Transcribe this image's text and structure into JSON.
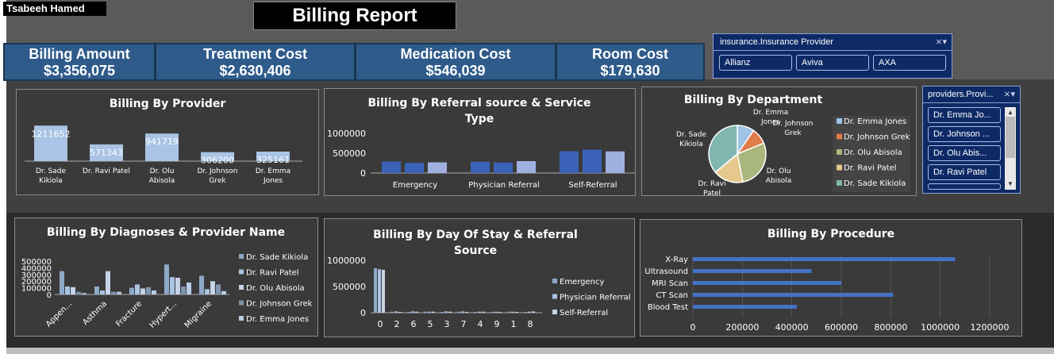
{
  "user_name": "Tsabeeh Hamed",
  "report_title": "Billing Report",
  "kpis": [
    {
      "label": "Billing Amount",
      "value": "$3,356,075"
    },
    {
      "label": "Treatment Cost",
      "value": "$2,630,406"
    },
    {
      "label": "Medication Cost",
      "value": "$546,039"
    },
    {
      "label": "Room Cost",
      "value": "$179,630"
    }
  ],
  "insurance_slicer": {
    "title": "insurance.Insurance Provider",
    "items": [
      "Allianz",
      "Aviva",
      "AXA"
    ]
  },
  "providers_slicer": {
    "title": "providers.Provi...",
    "items": [
      "Dr. Emma Jo...",
      "Dr. Johnson ...",
      "Dr. Olu Abis...",
      "Dr. Ravi Patel"
    ]
  },
  "colors": {
    "bar_light": "#a9c4e4",
    "bar_dark": "#3a63b8",
    "bar_pale": "#9fb0e0",
    "procedure_bar": "#4472c4"
  },
  "chart_data": [
    {
      "type": "bar",
      "title": "Billing By Provider",
      "categories": [
        "Dr. Sade Kikiola",
        "Dr. Ravi Patel",
        "Dr. Olu Abisola",
        "Dr. Johnson Grek",
        "Dr. Emma Jones"
      ],
      "values": [
        1211652,
        571343,
        941719,
        306200,
        325161
      ],
      "data_labels": [
        "1211652",
        "571343",
        "941719",
        "306200",
        "325161"
      ],
      "cat_lines": [
        [
          "Dr. Sade",
          "Kikiola"
        ],
        [
          "Dr. Ravi Patel"
        ],
        [
          "Dr. Olu",
          "Abisola"
        ],
        [
          "Dr. Johnson",
          "Grek"
        ],
        [
          "Dr. Emma",
          "Jones"
        ]
      ],
      "ylim": [
        0,
        1300000
      ]
    },
    {
      "type": "bar",
      "title": "Billing By Referral source & Service Type",
      "categories": [
        "Emergency",
        "Physician Referral",
        "Self-Referral"
      ],
      "series": [
        {
          "values": [
            290000,
            285000,
            550000
          ]
        },
        {
          "values": [
            255000,
            265000,
            590000
          ]
        },
        {
          "values": [
            270000,
            300000,
            545000
          ]
        }
      ],
      "yticks": [
        "1000000",
        "500000",
        "0"
      ],
      "ylim": [
        0,
        1000000
      ]
    },
    {
      "type": "pie",
      "title": "Billing By Department",
      "legend": [
        "Dr. Emma Jones",
        "Dr. Johnson Grek",
        "Dr. Olu Abisola",
        "Dr. Ravi Patel",
        "Dr. Sade Kikiola"
      ],
      "values": [
        325161,
        306200,
        941719,
        571343,
        1211652
      ],
      "labels": [
        [
          "Dr. Emma",
          "Jones"
        ],
        [
          "Dr. Johnson",
          "Grek"
        ],
        [
          "Dr. Olu",
          "Abisola"
        ],
        [
          "Dr. Ravi",
          "Patel"
        ],
        [
          "Dr. Sade",
          "Kikiola"
        ]
      ],
      "colors": [
        "#9dc3e6",
        "#e07b4a",
        "#a9b77c",
        "#e6c88c",
        "#7fb7b0"
      ]
    },
    {
      "type": "bar",
      "title": "Billing By Diagnoses & Provider Name",
      "categories": [
        "Appen...",
        "Asthma",
        "Fracture",
        "Hypert...",
        "Migraine"
      ],
      "legend": [
        "Dr. Sade Kikiola",
        "Dr. Ravi Patel",
        "Dr. Olu Abisola",
        "Dr. Johnson Grek",
        "Dr. Emma Jones"
      ],
      "series": [
        {
          "name": "Dr. Sade Kikiola",
          "values": [
            350000,
            120000,
            100000,
            450000,
            280000
          ]
        },
        {
          "name": "Dr. Ravi Patel",
          "values": [
            120000,
            60000,
            150000,
            260000,
            80000
          ]
        },
        {
          "name": "Dr. Olu Abisola",
          "values": [
            110000,
            350000,
            90000,
            250000,
            200000
          ]
        },
        {
          "name": "Dr. Johnson Grek",
          "values": [
            40000,
            40000,
            110000,
            120000,
            150000
          ]
        },
        {
          "name": "Dr. Emma Jones",
          "values": [
            20000,
            40000,
            60000,
            180000,
            50000
          ]
        }
      ],
      "yticks": [
        "500000",
        "400000",
        "300000",
        "200000",
        "100000",
        "0"
      ],
      "ylim": [
        0,
        500000
      ]
    },
    {
      "type": "bar",
      "title": "Billing By Day Of Stay & Referral Source",
      "categories": [
        "0",
        "2",
        "6",
        "5",
        "3",
        "7",
        "4",
        "9",
        "1",
        "8"
      ],
      "legend": [
        "Emergency",
        "Physician Referral",
        "Self-Referral"
      ],
      "series": [
        {
          "name": "Emergency",
          "values": [
            850000,
            20000,
            15000,
            20000,
            15000,
            20000,
            15000,
            15000,
            20000,
            15000
          ]
        },
        {
          "name": "Physician Referral",
          "values": [
            830000,
            25000,
            25000,
            20000,
            25000,
            25000,
            20000,
            20000,
            20000,
            20000
          ]
        },
        {
          "name": "Self-Referral",
          "values": [
            820000,
            15000,
            20000,
            20000,
            20000,
            15000,
            20000,
            15000,
            15000,
            25000
          ]
        }
      ],
      "yticks": [
        "1000000",
        "500000",
        "0"
      ],
      "ylim": [
        0,
        1000000
      ]
    },
    {
      "type": "bar",
      "title": "Billing By Procedure",
      "categories": [
        "X-Ray",
        "Ultrasound",
        "MRI Scan",
        "CT Scan",
        "Blood Test"
      ],
      "values": [
        1060000,
        480000,
        600000,
        810000,
        420000
      ],
      "xticks": [
        "0",
        "200000",
        "400000",
        "600000",
        "800000",
        "1000000",
        "1200000"
      ],
      "xlim": [
        0,
        1200000
      ]
    }
  ]
}
